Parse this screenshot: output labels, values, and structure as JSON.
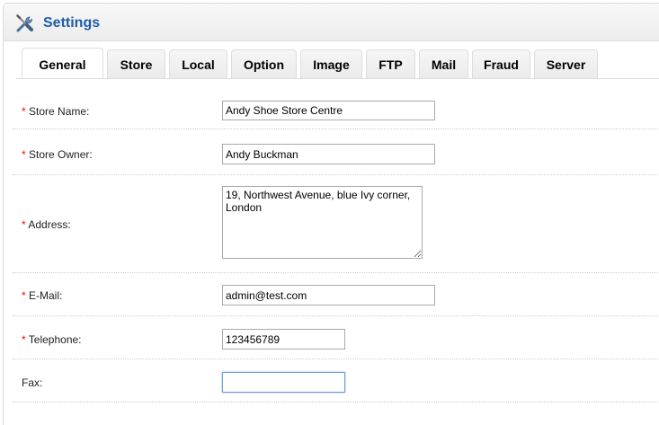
{
  "header": {
    "title": "Settings",
    "icon": "settings-tools-icon"
  },
  "tabs": [
    {
      "label": "General",
      "active": true
    },
    {
      "label": "Store",
      "active": false
    },
    {
      "label": "Local",
      "active": false
    },
    {
      "label": "Option",
      "active": false
    },
    {
      "label": "Image",
      "active": false
    },
    {
      "label": "FTP",
      "active": false
    },
    {
      "label": "Mail",
      "active": false
    },
    {
      "label": "Fraud",
      "active": false
    },
    {
      "label": "Server",
      "active": false
    }
  ],
  "form": {
    "required_mark": "*",
    "store_name": {
      "label": "Store Name:",
      "value": "Andy Shoe Store Centre",
      "required": true
    },
    "store_owner": {
      "label": "Store Owner:",
      "value": "Andy Buckman",
      "required": true
    },
    "address": {
      "label": "Address:",
      "value": "19, Northwest Avenue, blue Ivy corner, London",
      "required": true
    },
    "email": {
      "label": "E-Mail:",
      "value": "admin@test.com",
      "required": true
    },
    "telephone": {
      "label": "Telephone:",
      "value": "123456789",
      "required": true
    },
    "fax": {
      "label": "Fax:",
      "value": "",
      "required": false
    }
  },
  "colors": {
    "title": "#1d5ea8",
    "required": "#ff0000",
    "focus_border": "#6b9bd6"
  }
}
